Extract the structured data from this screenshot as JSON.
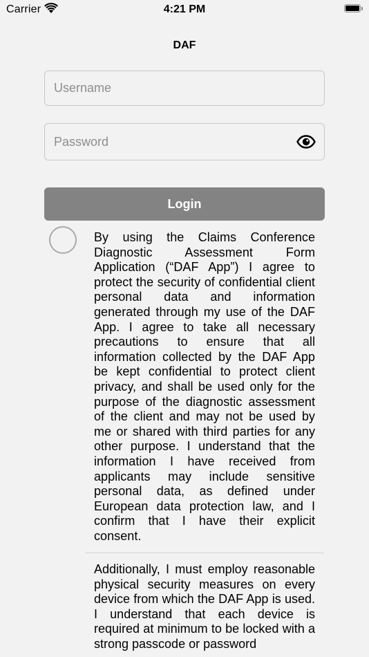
{
  "status_bar": {
    "carrier": "Carrier",
    "time": "4:21 PM"
  },
  "nav": {
    "title": "DAF"
  },
  "form": {
    "username_placeholder": "Username",
    "password_placeholder": "Password",
    "login_label": "Login"
  },
  "terms": {
    "paragraph_1": "By using the Claims Conference Diagnostic Assessment Form Application (“DAF App”) I agree to protect the security of confidential client personal data and information generated through my use of the DAF App.  I agree to take all necessary precautions to ensure that all information collected by the DAF App be kept confidential to protect client privacy, and shall be used only for the purpose of the diagnostic assessment of the client and may not be used by me or shared with third parties for any other purpose.  I understand that the information I have received from applicants may include sensitive personal data, as defined under European data protection law, and I confirm that I have their explicit consent.",
    "paragraph_2": "Additionally, I must employ reasonable physical security measures on every device from which the DAF App is used.  I understand that each device is required at minimum to be locked with a strong passcode or password"
  },
  "colors": {
    "background": "#f2f2f2",
    "button": "#838383",
    "field_border": "#c8c8c8"
  },
  "icons": {
    "wifi": "wifi-icon",
    "battery": "battery-icon",
    "eye": "eye-icon",
    "checkbox": "radio-circle"
  }
}
